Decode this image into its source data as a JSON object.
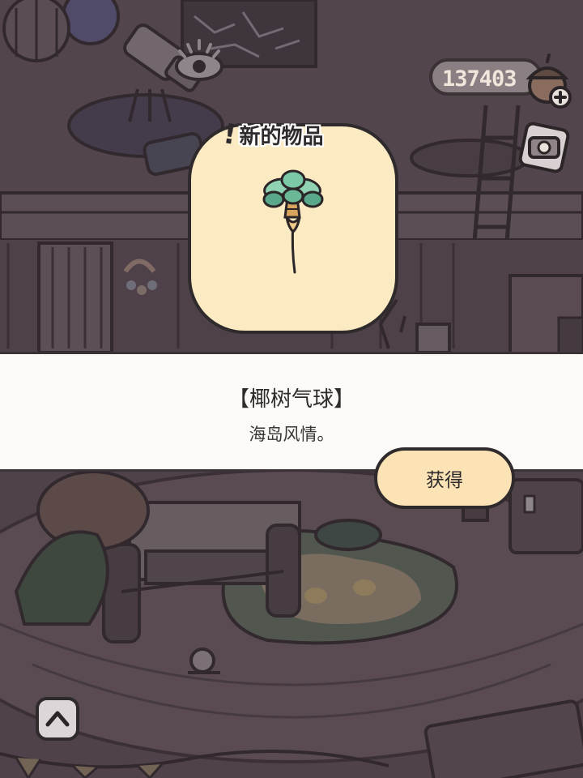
{
  "hud": {
    "coin_count": "137403",
    "icons": {
      "currency": "acorn-icon",
      "add": "plus-icon",
      "camera": "camera-icon",
      "view": "eye-icon"
    }
  },
  "popup": {
    "header": "新的物品",
    "header_icon": "exclamation-icon",
    "item_icon": "palm-tree-balloon-icon",
    "item_name": "【椰树气球】",
    "item_description": "海岛风情。",
    "obtain_label": "获得"
  },
  "controls": {
    "scroll_up_icon": "chevron-up-icon"
  },
  "colors": {
    "card_fill": "#fbeac2",
    "button_fill": "#fbe3b6",
    "banner_fill": "#fbfaf6",
    "outline": "#2f2a2c"
  }
}
